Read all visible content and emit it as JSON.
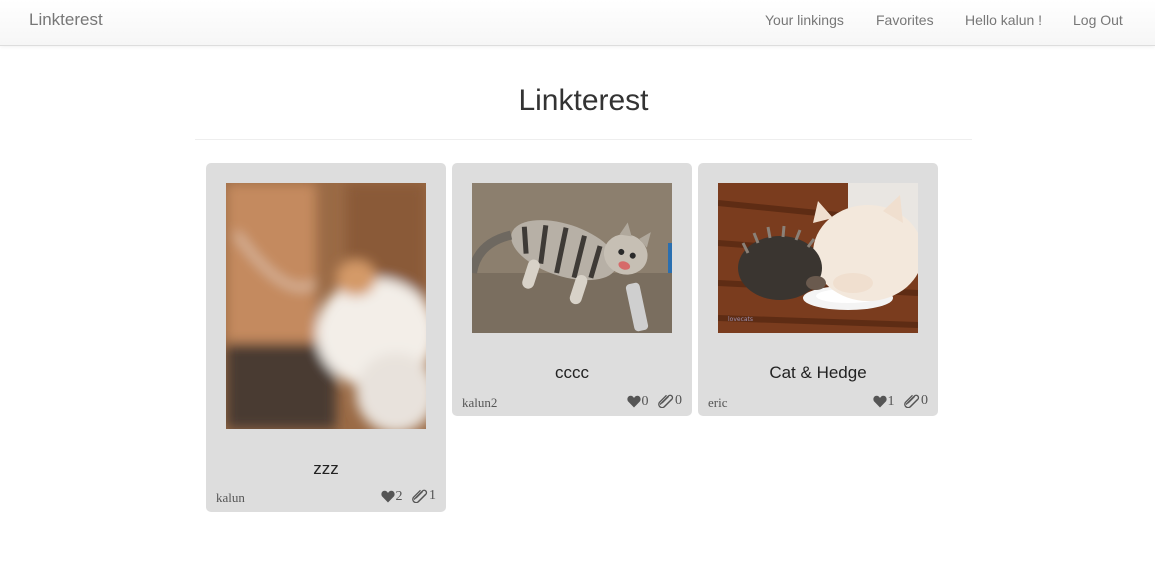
{
  "navbar": {
    "brand": "Linkterest",
    "links": [
      {
        "label": "Your linkings"
      },
      {
        "label": "Favorites"
      },
      {
        "label": "Hello kalun !"
      },
      {
        "label": "Log Out"
      }
    ]
  },
  "page": {
    "title": "Linkterest"
  },
  "pins": [
    {
      "title": "zzz",
      "author": "kalun",
      "likes": "2",
      "attachments": "1",
      "image": "blurred cat photo"
    },
    {
      "title": "cccc",
      "author": "kalun2",
      "likes": "0",
      "attachments": "0",
      "image": "tabby cat lying on floor"
    },
    {
      "title": "Cat & Hedge",
      "author": "eric",
      "likes": "1",
      "attachments": "0",
      "image": "kitten and hedgehog drinking milk"
    }
  ],
  "icons": {
    "like": "heart-icon",
    "attachment": "paperclip-icon"
  },
  "colors": {
    "card_bg": "#dddddd",
    "nav_text": "#777777"
  }
}
